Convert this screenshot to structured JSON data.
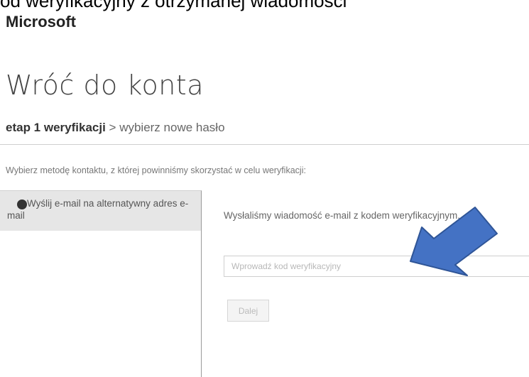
{
  "caption": "od weryfikacyjny z otrzymanej wiadomości",
  "brand": "Microsoft",
  "page_title": "Wróć do konta",
  "breadcrumb": {
    "current_step": "etap 1 weryfikacji",
    "separator": " > ",
    "next_step": "wybierz nowe hasło"
  },
  "instruction": "Wybierz metodę kontaktu, z której powinniśmy skorzystać w celu weryfikacji:",
  "methods": [
    {
      "label": "Wyślij e-mail na alternatywny adres e-mail",
      "selected": true
    }
  ],
  "detail": {
    "sent_message": "Wysłaliśmy wiadomość e-mail z kodem weryfikacyjnym.",
    "code_input": {
      "placeholder": "Wprowadź kod weryfikacyjny",
      "value": ""
    },
    "next_label": "Dalej"
  },
  "annotation": {
    "arrow_color": "#4472c4",
    "arrow_outline": "#2f5597",
    "icon": "arrow-pointing-to-input"
  }
}
